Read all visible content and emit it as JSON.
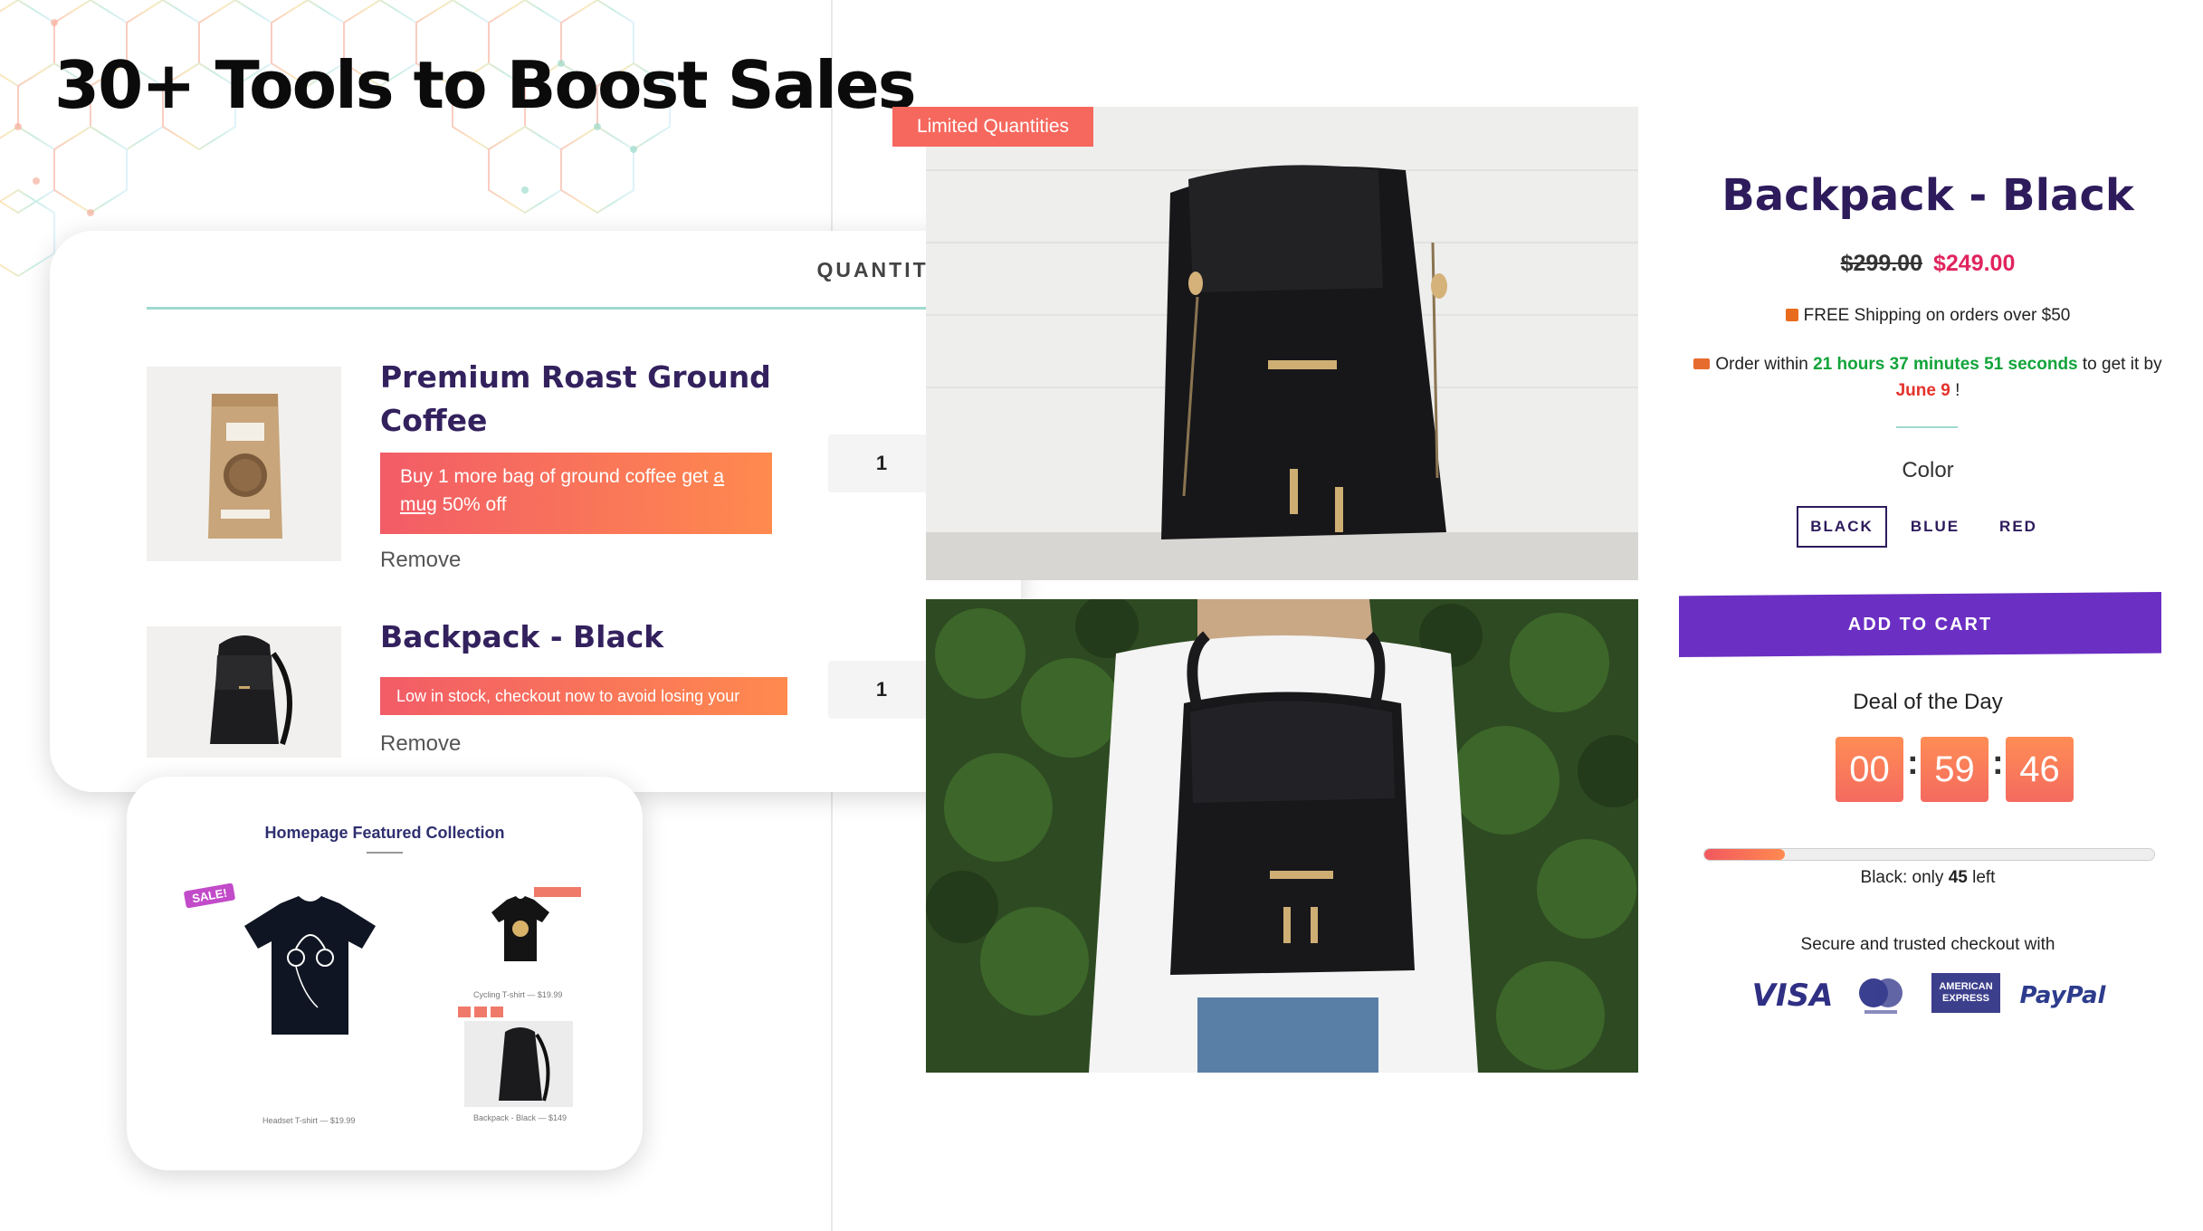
{
  "headline": "30+ Tools to Boost Sales",
  "cart": {
    "quantity_header": "QUANTITY",
    "items": [
      {
        "title_line1": "Premium Roast Ground",
        "title_line2": "Coffee",
        "upsell_text": "Buy 1 more bag of ground coffee get ",
        "upsell_link": "a mug",
        "upsell_suffix": " 50% off",
        "remove": "Remove",
        "quantity": "1"
      },
      {
        "title_line1": "Backpack - Black",
        "notice": "Low in stock, checkout now to avoid losing your deal",
        "remove": "Remove",
        "quantity": "1"
      }
    ]
  },
  "featured": {
    "title": "Homepage Featured Collection",
    "sale_badge": "SALE!"
  },
  "product": {
    "badge": "Limited Quantities",
    "title": "Backpack - Black",
    "price_old": "$299.00",
    "price_new": "$249.00",
    "shipping": "FREE Shipping on orders over $50",
    "order_prefix": "Order within ",
    "order_time": "21 hours 37 minutes 51 seconds",
    "order_mid": " to get it by ",
    "order_date": "June 9",
    "order_suffix": " !",
    "color_label": "Color",
    "colors": [
      "BLACK",
      "BLUE",
      "RED"
    ],
    "selected_color": "BLACK",
    "add_to_cart": "ADD TO CART",
    "deal_label": "Deal of the Day",
    "timer": {
      "hours": "00",
      "minutes": "59",
      "seconds": "46"
    },
    "stock_prefix": "Black: only ",
    "stock_count": "45",
    "stock_suffix": " left",
    "stock_fraction": 0.18,
    "secure_text": "Secure and trusted checkout with",
    "payments": {
      "visa": "VISA",
      "amex_line1": "AMERICAN",
      "amex_line2": "EXPRESS",
      "paypal": "PayPal"
    }
  },
  "colors": {
    "accent_purple": "#6b2fc3",
    "title_navy": "#2d1b5c",
    "sale_red": "#e0245e",
    "urgency_green": "#12a43a",
    "gradient_start": "#f25c67",
    "gradient_end": "#ff8a4e"
  },
  "icons": [
    "gift-icon",
    "truck-icon",
    "visa-logo",
    "mastercard-logo",
    "amex-logo",
    "paypal-logo"
  ]
}
